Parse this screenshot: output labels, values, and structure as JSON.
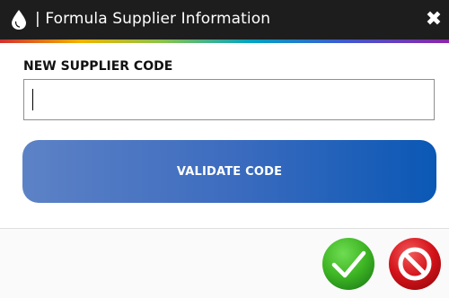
{
  "window": {
    "title": "| Formula Supplier Information",
    "close_glyph": "✖",
    "app_icon": "drop-icon"
  },
  "form": {
    "label": "NEW SUPPLIER CODE",
    "input_value": "",
    "input_placeholder": ""
  },
  "buttons": {
    "validate_label": "VALIDATE CODE",
    "ok_icon": "checkmark-icon",
    "cancel_icon": "prohibited-icon"
  },
  "colors": {
    "titlebar": "#1d1d1d",
    "validate_start": "#5d82c6",
    "validate_end": "#0a58b5",
    "ok_green": "#3db523",
    "cancel_red": "#d4121a"
  }
}
